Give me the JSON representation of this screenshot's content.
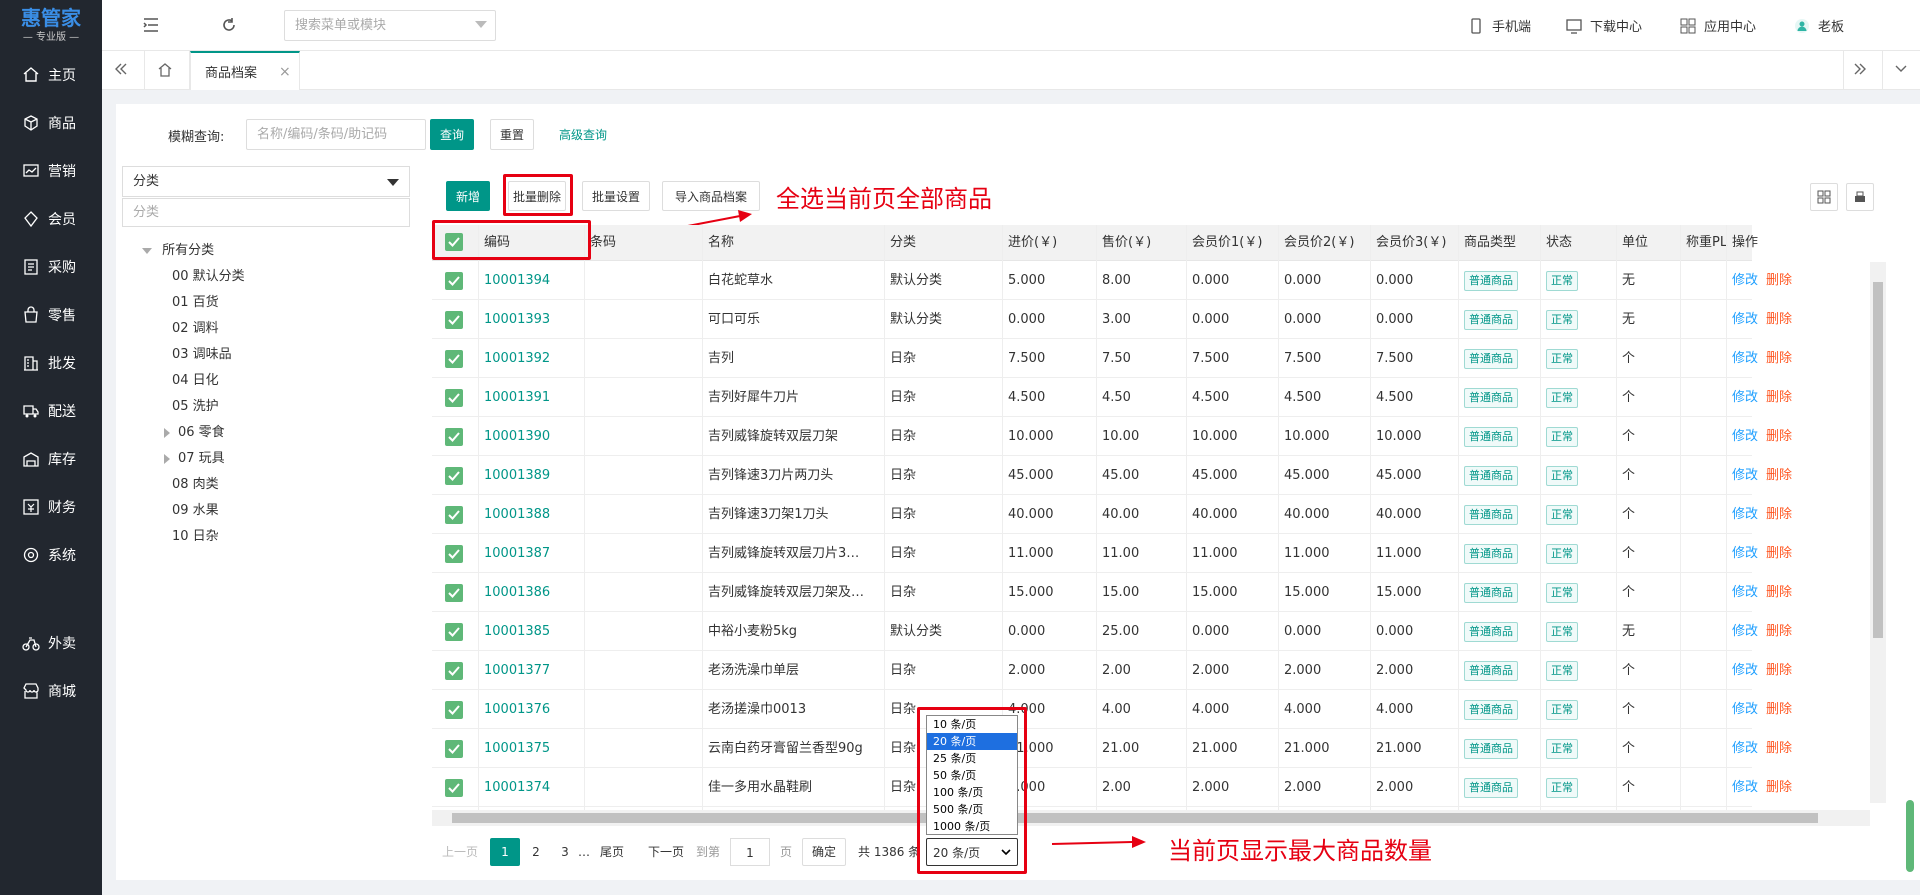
{
  "logo": {
    "title": "惠管家",
    "subtitle": "— 专业版 —"
  },
  "nav": [
    {
      "label": "主页",
      "icon": "home-icon"
    },
    {
      "label": "商品",
      "icon": "cube-icon"
    },
    {
      "label": "营销",
      "icon": "chart-icon"
    },
    {
      "label": "会员",
      "icon": "diamond-icon"
    },
    {
      "label": "采购",
      "icon": "purchase-icon"
    },
    {
      "label": "零售",
      "icon": "bag-icon"
    },
    {
      "label": "批发",
      "icon": "building-icon"
    },
    {
      "label": "配送",
      "icon": "truck-icon"
    },
    {
      "label": "库存",
      "icon": "warehouse-icon"
    },
    {
      "label": "财务",
      "icon": "finance-icon"
    },
    {
      "label": "系统",
      "icon": "settings-icon"
    },
    {
      "label": "外卖",
      "icon": "bike-icon"
    },
    {
      "label": "商城",
      "icon": "store-icon"
    }
  ],
  "topbar": {
    "search_placeholder": "搜索菜单或模块",
    "right": [
      {
        "label": "手机端",
        "icon": "phone-icon"
      },
      {
        "label": "下载中心",
        "icon": "download-icon"
      },
      {
        "label": "应用中心",
        "icon": "apps-icon"
      },
      {
        "label": "老板",
        "icon": "user-icon"
      }
    ]
  },
  "tabs": {
    "active": "商品档案"
  },
  "query": {
    "label": "模糊查询:",
    "placeholder": "名称/编码/条码/助记码",
    "search_btn": "查询",
    "reset_btn": "重置",
    "advanced": "高级查询"
  },
  "category": {
    "select_label": "分类",
    "filter_placeholder": "分类",
    "root": "所有分类",
    "items": [
      {
        "label": "00 默认分类",
        "expandable": false
      },
      {
        "label": "01 百货",
        "expandable": false
      },
      {
        "label": "02 调料",
        "expandable": false
      },
      {
        "label": "03 调味品",
        "expandable": false
      },
      {
        "label": "04 日化",
        "expandable": false
      },
      {
        "label": "05 洗护",
        "expandable": false
      },
      {
        "label": "06 零食",
        "expandable": true
      },
      {
        "label": "07 玩具",
        "expandable": true
      },
      {
        "label": "08 肉类",
        "expandable": false
      },
      {
        "label": "09 水果",
        "expandable": false
      },
      {
        "label": "10 日杂",
        "expandable": false
      }
    ]
  },
  "toolbar": {
    "add": "新增",
    "batch_delete": "批量删除",
    "batch_set": "批量设置",
    "import": "导入商品档案"
  },
  "annotations": {
    "select_all": "全选当前页全部商品",
    "page_size": "当前页显示最大商品数量"
  },
  "table": {
    "headers": [
      "编码",
      "条码",
      "名称",
      "分类",
      "进价(￥)",
      "售价(￥)",
      "会员价1(￥)",
      "会员价2(￥)",
      "会员价3(￥)",
      "商品类型",
      "状态",
      "单位",
      "称重PL",
      "操作"
    ],
    "edit": "修改",
    "delete": "删除",
    "rows": [
      {
        "code": "10001394",
        "barcode": "",
        "name": "白花蛇草水",
        "cat": "默认分类",
        "cost": "5.000",
        "price": "8.00",
        "m1": "0.000",
        "m2": "0.000",
        "m3": "0.000",
        "type": "普通商品",
        "status": "正常",
        "unit": "无"
      },
      {
        "code": "10001393",
        "barcode": "",
        "name": "可口可乐",
        "cat": "默认分类",
        "cost": "0.000",
        "price": "3.00",
        "m1": "0.000",
        "m2": "0.000",
        "m3": "0.000",
        "type": "普通商品",
        "status": "正常",
        "unit": "无"
      },
      {
        "code": "10001392",
        "barcode": "",
        "name": "吉列",
        "cat": "日杂",
        "cost": "7.500",
        "price": "7.50",
        "m1": "7.500",
        "m2": "7.500",
        "m3": "7.500",
        "type": "普通商品",
        "status": "正常",
        "unit": "个"
      },
      {
        "code": "10001391",
        "barcode": "",
        "name": "吉列好犀牛刀片",
        "cat": "日杂",
        "cost": "4.500",
        "price": "4.50",
        "m1": "4.500",
        "m2": "4.500",
        "m3": "4.500",
        "type": "普通商品",
        "status": "正常",
        "unit": "个"
      },
      {
        "code": "10001390",
        "barcode": "",
        "name": "吉列威锋旋转双层刀架",
        "cat": "日杂",
        "cost": "10.000",
        "price": "10.00",
        "m1": "10.000",
        "m2": "10.000",
        "m3": "10.000",
        "type": "普通商品",
        "status": "正常",
        "unit": "个"
      },
      {
        "code": "10001389",
        "barcode": "",
        "name": "吉列锋速3刀片两刀头",
        "cat": "日杂",
        "cost": "45.000",
        "price": "45.00",
        "m1": "45.000",
        "m2": "45.000",
        "m3": "45.000",
        "type": "普通商品",
        "status": "正常",
        "unit": "个"
      },
      {
        "code": "10001388",
        "barcode": "",
        "name": "吉列锋速3刀架1刀头",
        "cat": "日杂",
        "cost": "40.000",
        "price": "40.00",
        "m1": "40.000",
        "m2": "40.000",
        "m3": "40.000",
        "type": "普通商品",
        "status": "正常",
        "unit": "个"
      },
      {
        "code": "10001387",
        "barcode": "",
        "name": "吉列威锋旋转双层刀片3…",
        "cat": "日杂",
        "cost": "11.000",
        "price": "11.00",
        "m1": "11.000",
        "m2": "11.000",
        "m3": "11.000",
        "type": "普通商品",
        "status": "正常",
        "unit": "个"
      },
      {
        "code": "10001386",
        "barcode": "",
        "name": "吉列威锋旋转双层刀架及…",
        "cat": "日杂",
        "cost": "15.000",
        "price": "15.00",
        "m1": "15.000",
        "m2": "15.000",
        "m3": "15.000",
        "type": "普通商品",
        "status": "正常",
        "unit": "个"
      },
      {
        "code": "10001385",
        "barcode": "",
        "name": "中裕小麦粉5kg",
        "cat": "默认分类",
        "cost": "0.000",
        "price": "25.00",
        "m1": "0.000",
        "m2": "0.000",
        "m3": "0.000",
        "type": "普通商品",
        "status": "正常",
        "unit": "无"
      },
      {
        "code": "10001377",
        "barcode": "",
        "name": "老汤洗澡巾单层",
        "cat": "日杂",
        "cost": "2.000",
        "price": "2.00",
        "m1": "2.000",
        "m2": "2.000",
        "m3": "2.000",
        "type": "普通商品",
        "status": "正常",
        "unit": "个"
      },
      {
        "code": "10001376",
        "barcode": "",
        "name": "老汤搓澡巾0013",
        "cat": "日杂",
        "cost": "4.000",
        "price": "4.00",
        "m1": "4.000",
        "m2": "4.000",
        "m3": "4.000",
        "type": "普通商品",
        "status": "正常",
        "unit": "个"
      },
      {
        "code": "10001375",
        "barcode": "",
        "name": "云南白药牙膏留兰香型90g",
        "cat": "日杂",
        "cost": "21.000",
        "price": "21.00",
        "m1": "21.000",
        "m2": "21.000",
        "m3": "21.000",
        "type": "普通商品",
        "status": "正常",
        "unit": "个"
      },
      {
        "code": "10001374",
        "barcode": "",
        "name": "佳一多用水晶鞋刷",
        "cat": "日杂",
        "cost": "2.000",
        "price": "2.00",
        "m1": "2.000",
        "m2": "2.000",
        "m3": "2.000",
        "type": "普通商品",
        "status": "正常",
        "unit": "个"
      }
    ]
  },
  "pager": {
    "prev": "上一页",
    "pages": [
      "1",
      "2",
      "3"
    ],
    "ellipsis": "…",
    "last": "尾页",
    "next": "下一页",
    "goto": "到第",
    "goto_value": "1",
    "page_unit": "页",
    "confirm": "确定",
    "total": "共 1386 条",
    "page_size": "20 条/页",
    "options": [
      "10 条/页",
      "20 条/页",
      "25 条/页",
      "50 条/页",
      "100 条/页",
      "500 条/页",
      "1000 条/页"
    ],
    "selected_option_index": 1
  },
  "colors": {
    "sidebar": "#22272f",
    "primary": "#009688",
    "checkbox": "#5fb878",
    "annotation": "#e60012",
    "edit": "#1e9fff",
    "delete": "#ff5722"
  }
}
